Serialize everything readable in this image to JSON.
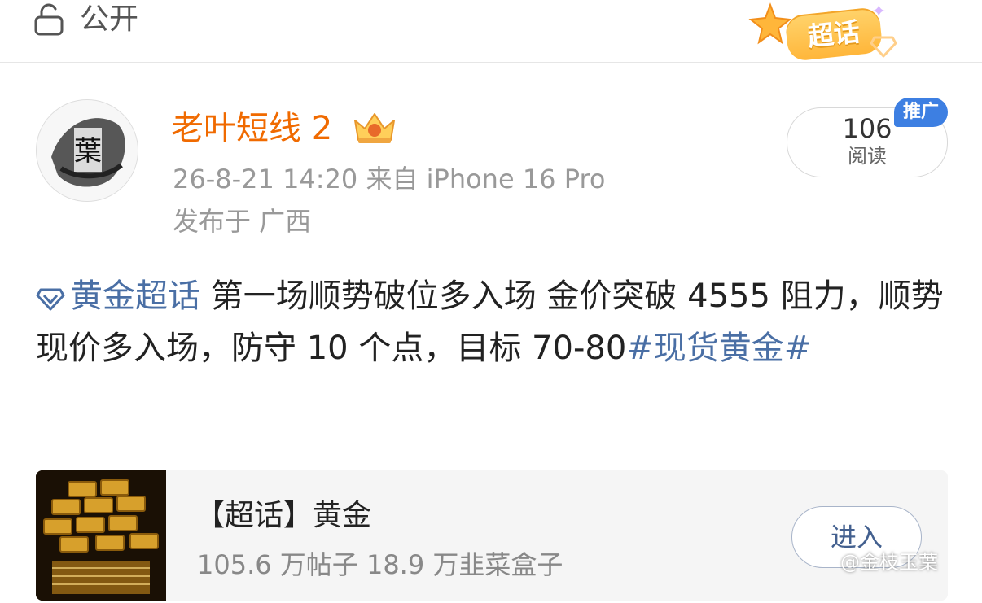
{
  "header": {
    "privacy_label": "公开",
    "badge_label": "超话"
  },
  "post": {
    "author": "老叶短线 2",
    "meta": "26-8-21 14:20  来自 iPhone 16 Pro",
    "location": "发布于 广西",
    "read_count": "106",
    "read_label": "阅读",
    "promo_label": "推广",
    "body": {
      "topic_link": "黄金超话",
      "main_text": "  第一场顺势破位多入场 金价突破 4555 阻力，顺势现价多入场，防守 10 个点，目标 70-80",
      "hashtag": "#现货黄金#"
    }
  },
  "topic_card": {
    "title": "【超话】黄金",
    "stats": "105.6 万帖子 18.9 万韭菜盒子",
    "enter_label": "进入"
  },
  "watermark": "@金枝玉葉",
  "colors": {
    "author": "#f06a00",
    "link": "#4a6fa5",
    "promo_tag": "#3d7fe2",
    "badge": "#ffb63a"
  }
}
